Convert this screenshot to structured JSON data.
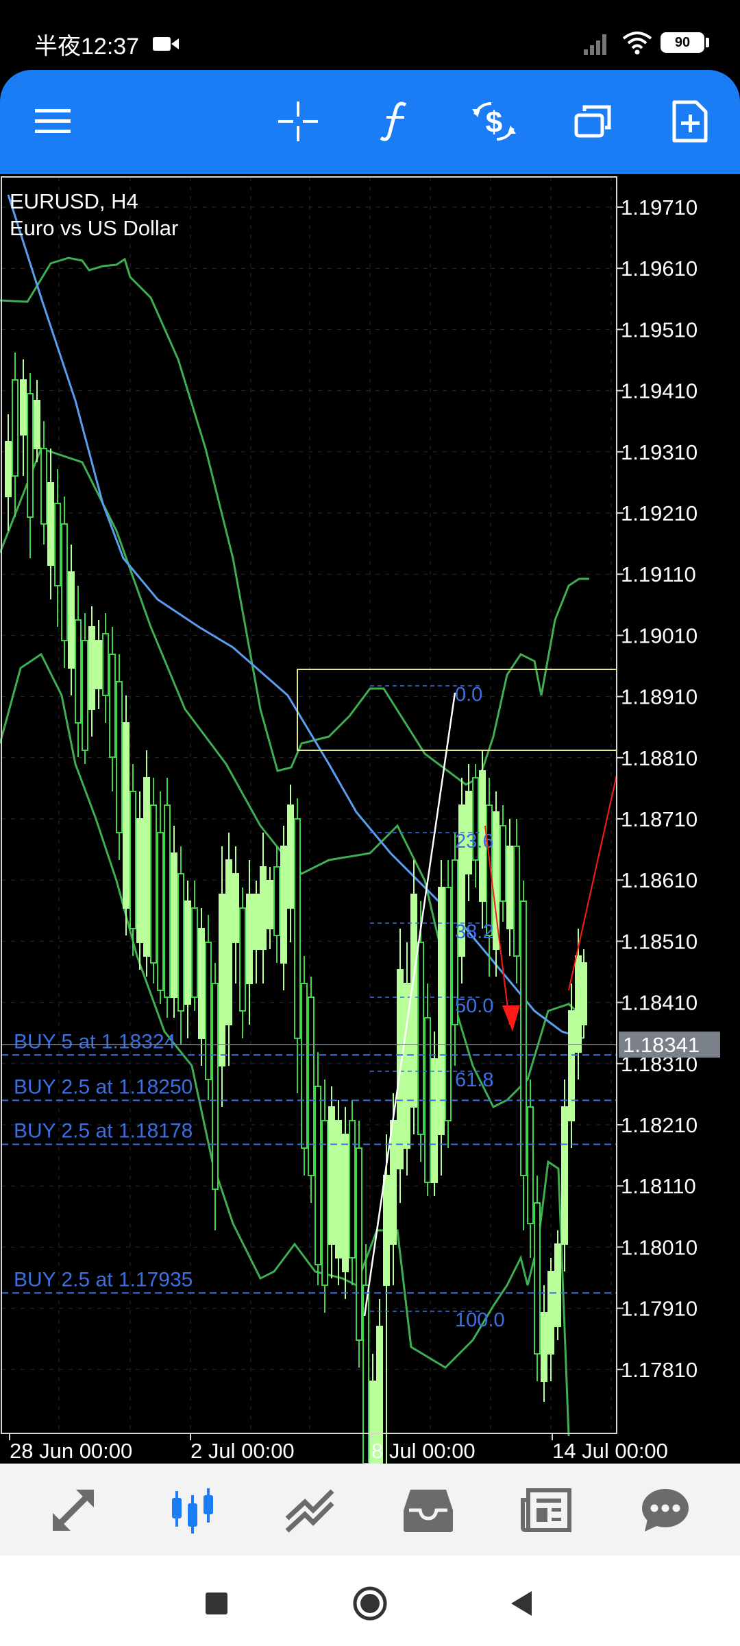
{
  "status_bar": {
    "time": "半夜12:37",
    "battery": "90",
    "icons": [
      "video-camera-icon",
      "signal-icon",
      "wifi-icon",
      "battery-icon"
    ]
  },
  "toolbar": {
    "icons": [
      "menu-icon",
      "crosshair-icon",
      "function-icon",
      "trade-icon",
      "windows-icon",
      "new-document-icon"
    ],
    "color": "#1b7df5"
  },
  "chart": {
    "symbol_line": "EURUSD, H4",
    "description": "Euro vs US Dollar",
    "current_price": "1.18341",
    "price_labels": [
      "1.19710",
      "1.19610",
      "1.19510",
      "1.19410",
      "1.19310",
      "1.19210",
      "1.19110",
      "1.19010",
      "1.18910",
      "1.18810",
      "1.18710",
      "1.18610",
      "1.18510",
      "1.18410",
      "1.18310",
      "1.18210",
      "1.18110",
      "1.18010",
      "1.17910",
      "1.17810"
    ],
    "time_labels": [
      "28 Jun 00:00",
      "2 Jul 00:00",
      "8 Jul 00:00",
      "14 Jul 00:00"
    ],
    "orders": [
      {
        "label": "BUY 5 at 1.18324",
        "price": 1.18324
      },
      {
        "label": "BUY 2.5 at 1.18250",
        "price": 1.1825
      },
      {
        "label": "BUY 2.5 at 1.18178",
        "price": 1.18178
      },
      {
        "label": "BUY 2.5 at 1.17935",
        "price": 1.17935
      }
    ],
    "fibo_levels": [
      "0.0",
      "23.6",
      "38.2",
      "50.0",
      "61.8",
      "100.0"
    ],
    "colors": {
      "bull_candle": "#b8ff9a",
      "bear_candle": "#3fd64a",
      "bands": "#3fae52",
      "moving_average": "#5b9ef0",
      "order_line": "#3d6fe0",
      "fibo": "#3d6fe0",
      "rectangle": "#e9e98c",
      "arrow": "#ff1a1a",
      "trendline": "#ffffff",
      "price_tag": "#7a8088"
    }
  },
  "bottom_nav": {
    "items": [
      "quotes-icon",
      "chart-icon",
      "trade-icon",
      "history-icon",
      "news-icon",
      "chat-icon"
    ],
    "active_index": 1,
    "active_color": "#1b7df5"
  },
  "system_nav": {
    "items": [
      "recent-apps-icon",
      "home-icon",
      "back-icon"
    ]
  }
}
